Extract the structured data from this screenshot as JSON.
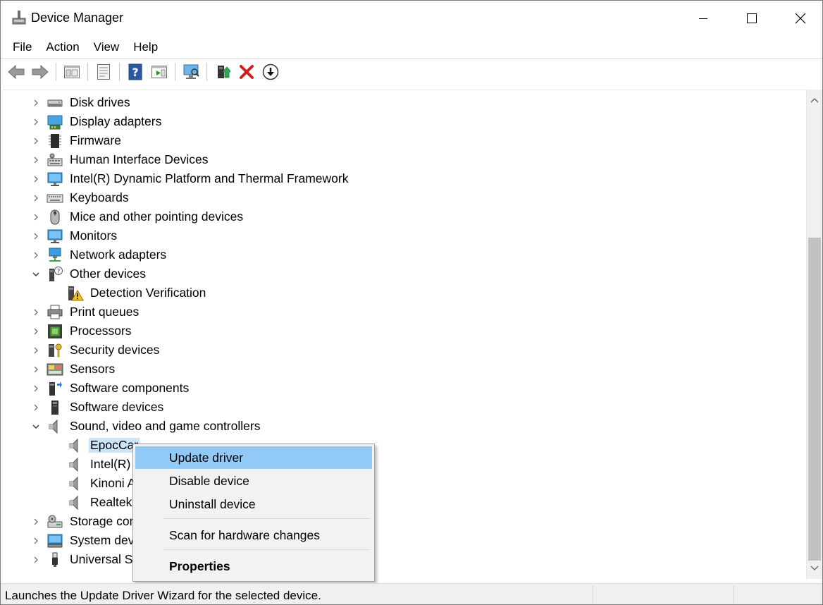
{
  "window": {
    "title": "Device Manager"
  },
  "menu": [
    "File",
    "Action",
    "View",
    "Help"
  ],
  "toolbar": [
    {
      "icon": "back-arrow-icon"
    },
    {
      "icon": "forward-arrow-icon"
    },
    {
      "icon": "show-hide-console-tree-icon"
    },
    {
      "icon": "properties-icon"
    },
    {
      "icon": "help-icon"
    },
    {
      "icon": "action-pane-icon"
    },
    {
      "icon": "scan-hardware-icon"
    },
    {
      "icon": "update-driver-icon"
    },
    {
      "icon": "uninstall-device-icon"
    },
    {
      "icon": "download-icon"
    }
  ],
  "tree": [
    {
      "label": "Disk drives",
      "level": 0,
      "expander": "collapsed",
      "icon": "disk-drive-icon"
    },
    {
      "label": "Display adapters",
      "level": 0,
      "expander": "collapsed",
      "icon": "display-adapter-icon"
    },
    {
      "label": "Firmware",
      "level": 0,
      "expander": "collapsed",
      "icon": "firmware-chip-icon"
    },
    {
      "label": "Human Interface Devices",
      "level": 0,
      "expander": "collapsed",
      "icon": "hid-keyboard-icon"
    },
    {
      "label": "Intel(R) Dynamic Platform and Thermal Framework",
      "level": 0,
      "expander": "collapsed",
      "icon": "monitor-icon"
    },
    {
      "label": "Keyboards",
      "level": 0,
      "expander": "collapsed",
      "icon": "keyboard-icon"
    },
    {
      "label": "Mice and other pointing devices",
      "level": 0,
      "expander": "collapsed",
      "icon": "mouse-icon"
    },
    {
      "label": "Monitors",
      "level": 0,
      "expander": "collapsed",
      "icon": "monitor-icon"
    },
    {
      "label": "Network adapters",
      "level": 0,
      "expander": "collapsed",
      "icon": "network-adapter-icon"
    },
    {
      "label": "Other devices",
      "level": 0,
      "expander": "expanded",
      "icon": "unknown-device-icon"
    },
    {
      "label": "Detection Verification",
      "level": 1,
      "expander": "none",
      "icon": "warning-device-icon"
    },
    {
      "label": "Print queues",
      "level": 0,
      "expander": "collapsed",
      "icon": "printer-icon"
    },
    {
      "label": "Processors",
      "level": 0,
      "expander": "collapsed",
      "icon": "processor-icon"
    },
    {
      "label": "Security devices",
      "level": 0,
      "expander": "collapsed",
      "icon": "security-key-icon"
    },
    {
      "label": "Sensors",
      "level": 0,
      "expander": "collapsed",
      "icon": "sensor-icon"
    },
    {
      "label": "Software components",
      "level": 0,
      "expander": "collapsed",
      "icon": "software-component-icon"
    },
    {
      "label": "Software devices",
      "level": 0,
      "expander": "collapsed",
      "icon": "software-device-icon"
    },
    {
      "label": "Sound, video and game controllers",
      "level": 0,
      "expander": "expanded",
      "icon": "speaker-icon"
    },
    {
      "label": "EpocCar",
      "level": 1,
      "expander": "none",
      "icon": "speaker-icon",
      "selected": true
    },
    {
      "label": "Intel(R)",
      "level": 1,
      "expander": "none",
      "icon": "speaker-icon"
    },
    {
      "label": "Kinoni A",
      "level": 1,
      "expander": "none",
      "icon": "speaker-icon"
    },
    {
      "label": "Realtek",
      "level": 1,
      "expander": "none",
      "icon": "speaker-icon"
    },
    {
      "label": "Storage cor",
      "level": 0,
      "expander": "collapsed",
      "icon": "storage-controller-icon"
    },
    {
      "label": "System dev",
      "level": 0,
      "expander": "collapsed",
      "icon": "system-device-icon"
    },
    {
      "label": "Universal S",
      "level": 0,
      "expander": "collapsed",
      "icon": "usb-icon"
    }
  ],
  "context_menu": {
    "items": [
      {
        "label": "Update driver",
        "highlighted": true
      },
      {
        "label": "Disable device"
      },
      {
        "label": "Uninstall device"
      },
      {
        "label": "Scan for hardware changes"
      },
      {
        "label": "Properties",
        "bold": true
      }
    ]
  },
  "status": {
    "text": "Launches the Update Driver Wizard for the selected device."
  },
  "colors": {
    "selection": "#cce4f7",
    "menu_highlight": "#91c9f7",
    "menu_bg": "#f2f2f2",
    "statusbar_bg": "#f0f0f0"
  }
}
